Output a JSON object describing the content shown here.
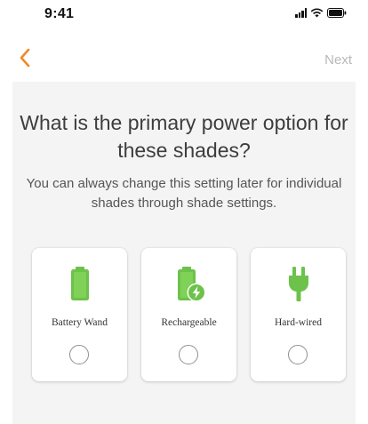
{
  "status_bar": {
    "time": "9:41"
  },
  "nav": {
    "back_icon": "chevron-left-icon",
    "next_label": "Next",
    "accent_color": "#f0892a"
  },
  "main": {
    "title": "What is the primary power option for these shades?",
    "subtitle": "You can always change this setting later for individual shades through shade settings."
  },
  "options": [
    {
      "label": "Battery Wand",
      "icon": "battery-icon",
      "selected": false
    },
    {
      "label": "Rechargeable",
      "icon": "rechargeable-battery-icon",
      "selected": false
    },
    {
      "label": "Hard-wired",
      "icon": "power-plug-icon",
      "selected": false
    }
  ],
  "colors": {
    "icon_green": "#6cc24a",
    "background": "#f4f4f4"
  }
}
